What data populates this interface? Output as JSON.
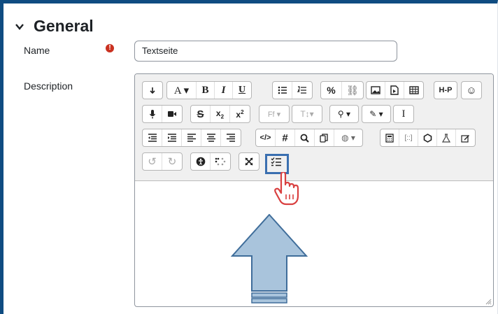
{
  "section": {
    "title": "General"
  },
  "fields": {
    "name_label": "Name",
    "name_value": "Textseite",
    "required_mark": "!",
    "description_label": "Description"
  },
  "toolbar": {
    "row1": [
      [
        "collapse-icon"
      ],
      [
        "font-size-icon",
        "bold-icon",
        "italic-icon",
        "underline-icon"
      ],
      [
        "unordered-list-icon",
        "ordered-list-icon"
      ],
      [
        "link-icon",
        "unlink-icon"
      ],
      [
        "image-icon",
        "media-icon",
        "table-icon"
      ],
      [
        "h5p-icon"
      ],
      [
        "emoji-icon"
      ]
    ],
    "row2": [
      [
        "record-audio-icon",
        "record-video-icon"
      ],
      [
        "strikethrough-icon",
        "subscript-icon",
        "superscript-icon"
      ],
      [
        "font-family-icon"
      ],
      [
        "font-size-select-icon"
      ],
      [
        "highlight-icon"
      ],
      [
        "font-color-icon"
      ],
      [
        "clear-formatting-icon"
      ]
    ],
    "row3": [
      [
        "outdent-icon",
        "indent-icon",
        "align-left-icon",
        "align-center-icon",
        "align-right-icon"
      ],
      [
        "html-icon",
        "hashtag-icon",
        "search-icon",
        "copy-icon",
        "language-icon"
      ],
      [
        "calculator-icon",
        "brackets-icon",
        "shape-icon",
        "flask-icon",
        "edit-icon"
      ]
    ],
    "row4": [
      [
        "undo-icon",
        "redo-icon"
      ],
      [
        "accessibility-icon",
        "braille-icon"
      ],
      [
        "fullscreen-icon"
      ],
      [
        "checklist-icon"
      ]
    ]
  }
}
